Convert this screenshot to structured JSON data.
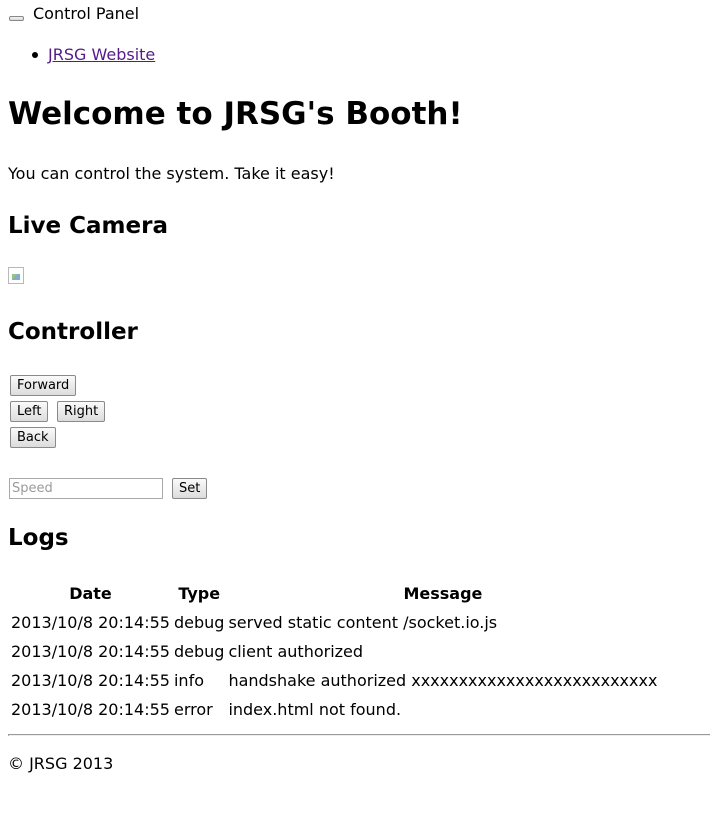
{
  "navbar": {
    "brand": "Control Panel",
    "links": [
      {
        "label": " JRSG Website"
      }
    ]
  },
  "header": {
    "title": "Welcome to JRSG's Booth!",
    "intro": "You can control the system. Take it easy!"
  },
  "camera": {
    "heading": "Live Camera",
    "image_icon": "broken-image-icon"
  },
  "controller": {
    "heading": "Controller",
    "forward_label": "Forward",
    "left_label": "Left",
    "right_label": "Right",
    "back_label": "Back",
    "speed_placeholder": "Speed",
    "speed_value": "",
    "set_label": "Set"
  },
  "logs": {
    "heading": "Logs",
    "columns": [
      "Date",
      "Type",
      "Message"
    ],
    "rows": [
      [
        "2013/10/8 20:14:55",
        "debug",
        "served static content /socket.io.js"
      ],
      [
        "2013/10/8 20:14:55",
        "debug",
        "client authorized"
      ],
      [
        "2013/10/8 20:14:55",
        "info",
        "handshake authorized xxxxxxxxxxxxxxxxxxxxxxxxxx"
      ],
      [
        "2013/10/8 20:14:55",
        "error",
        "index.html not found."
      ]
    ]
  },
  "footer": {
    "text": "© JRSG 2013"
  },
  "colors": {
    "link_visited": "#551a8b",
    "text": "#000000",
    "background": "#ffffff"
  }
}
